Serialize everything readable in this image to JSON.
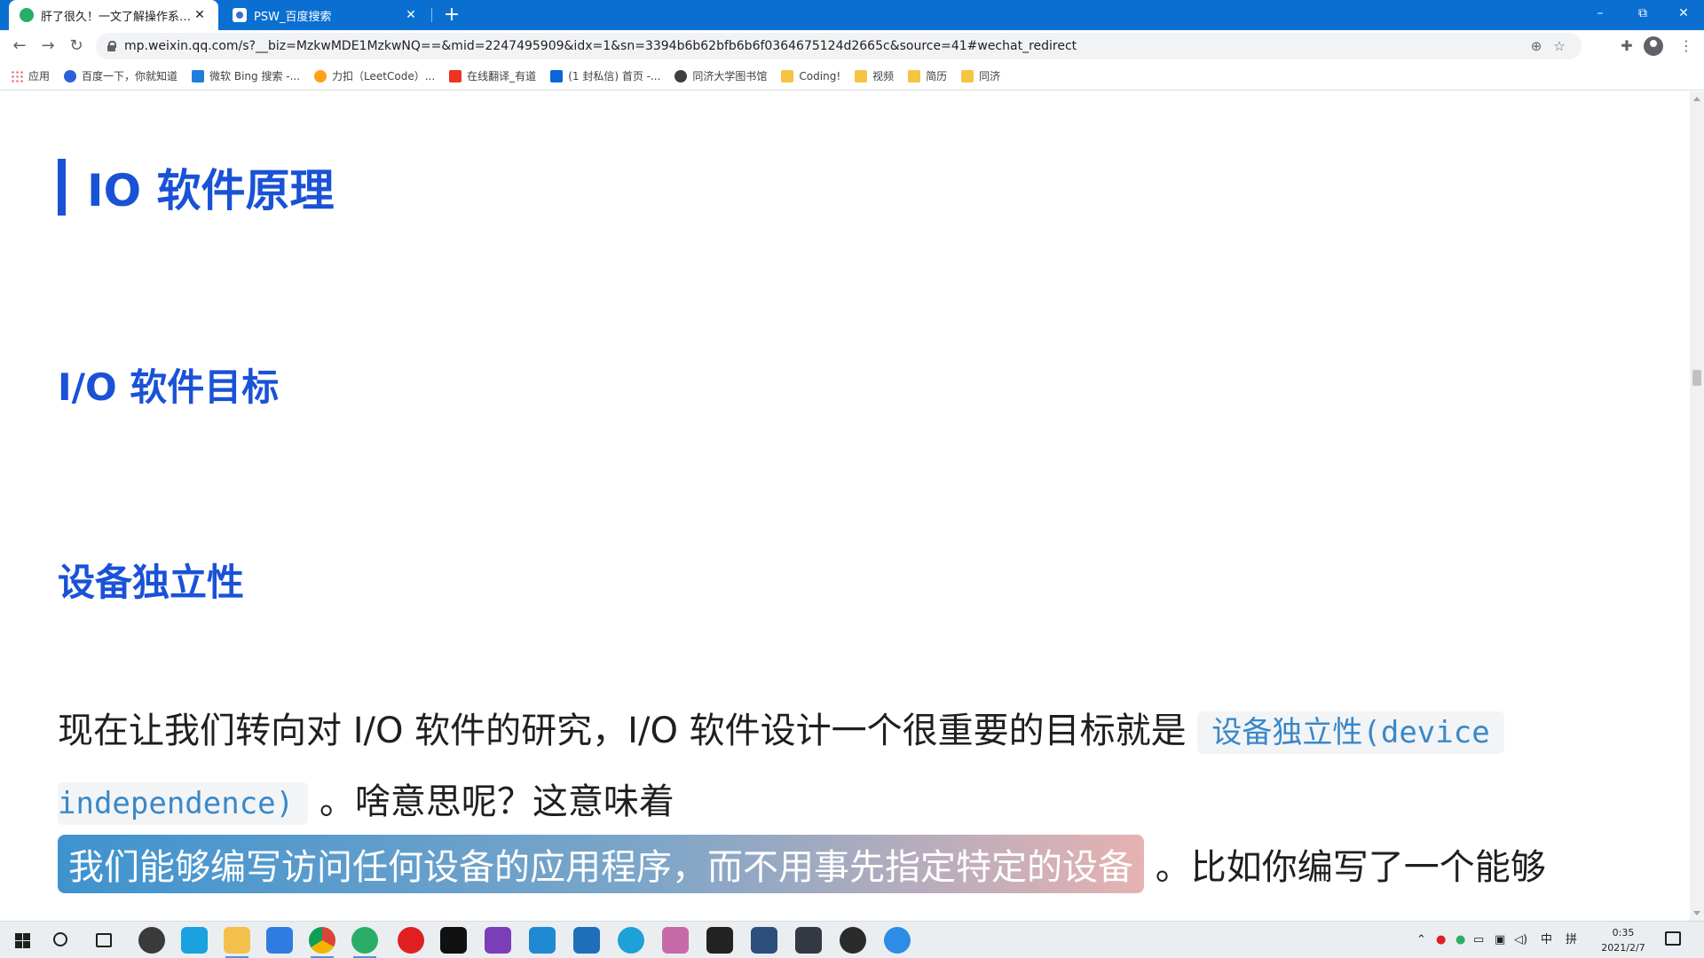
{
  "tabs": [
    {
      "title": "肝了很久！一文了解操作系统 I/O",
      "active": true
    },
    {
      "title": "PSW_百度搜索",
      "active": false
    }
  ],
  "window_controls": {
    "minimize": "–",
    "restore": "⧉",
    "close": "✕"
  },
  "toolbar": {
    "back": "←",
    "forward": "→",
    "reload": "↻",
    "url": "mp.weixin.qq.com/s?__biz=MzkwMDE1MzkwNQ==&mid=2247495909&idx=1&sn=3394b6b62bfb6b6f0364675124d2665c&source=41#wechat_redirect",
    "zoom_icon": "⊕",
    "star_icon": "☆",
    "extensions_icon": "✚",
    "menu_icon": "⋮"
  },
  "bookmarks": [
    {
      "label": "应用",
      "icon": "apps"
    },
    {
      "label": "百度一下，你就知道",
      "icon": "baidu"
    },
    {
      "label": "微软 Bing 搜索 -...",
      "icon": "bing"
    },
    {
      "label": "力扣（LeetCode）...",
      "icon": "leet"
    },
    {
      "label": "在线翻译_有道",
      "icon": "youdao"
    },
    {
      "label": "(1 封私信) 首页 -...",
      "icon": "zhihu"
    },
    {
      "label": "同济大学图书馆",
      "icon": "globe"
    },
    {
      "label": "Coding!",
      "icon": "folder"
    },
    {
      "label": "视频",
      "icon": "folder"
    },
    {
      "label": "简历",
      "icon": "folder"
    },
    {
      "label": "同济",
      "icon": "folder"
    }
  ],
  "article": {
    "h1": "IO 软件原理",
    "h2_goals": "I/O 软件目标",
    "h2_independence": "设备独立性",
    "para_line1_text": "现在让我们转向对 I/O 软件的研究，I/O 软件设计一个很重要的目标就是",
    "para_line1_code": "设备独立性(device",
    "para_line2_code": "independence)",
    "para_line2_text": "。啥意思呢？这意味着",
    "para_line3_highlight": "我们能够编写访问任何设备的应用程序，而不用事先指定特定的设备",
    "para_line3_text": "。比如你编写了一个能够"
  },
  "taskbar": {
    "ime": "中",
    "ime_mode": "拼",
    "time": "0:35",
    "date": "2021/2/7"
  },
  "colors": {
    "tab_strip": "#0a6fd0",
    "heading_blue": "#1a52d6",
    "code_blue": "#3a88c8"
  }
}
